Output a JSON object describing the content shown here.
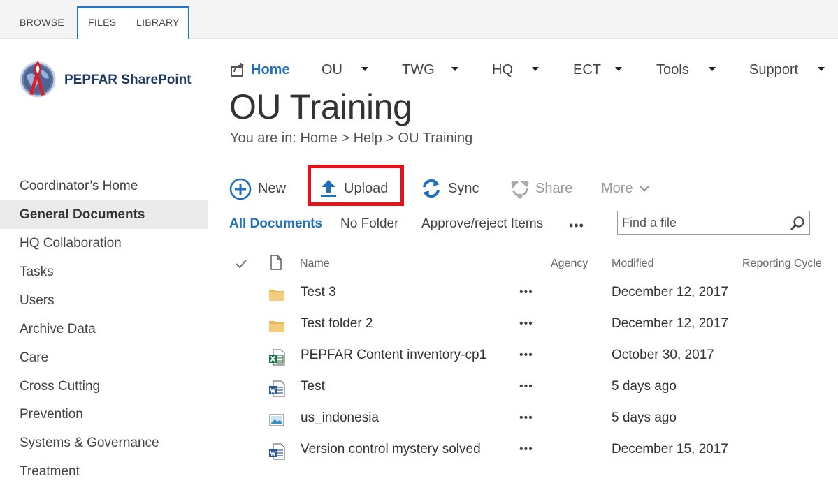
{
  "ribbon": {
    "tabs": [
      "BROWSE",
      "FILES",
      "LIBRARY"
    ]
  },
  "logo": {
    "text": "PEPFAR SharePoint"
  },
  "topnav": {
    "home": "Home",
    "items": [
      "OU",
      "TWG",
      "HQ",
      "ECT",
      "Tools",
      "Support"
    ]
  },
  "page": {
    "title": "OU Training",
    "breadcrumb": "You are in: Home > Help > OU Training"
  },
  "leftnav": {
    "items": [
      "Coordinator’s Home",
      "General Documents",
      "HQ Collaboration",
      "Tasks",
      "Users",
      "Archive Data",
      "Care",
      "Cross Cutting",
      "Prevention",
      "Systems & Governance",
      "Treatment"
    ],
    "selected": "General Documents"
  },
  "commands": {
    "new": "New",
    "upload": "Upload",
    "sync": "Sync",
    "share": "Share",
    "more": "More"
  },
  "views": {
    "items": [
      "All Documents",
      "No Folder",
      "Approve/reject Items"
    ],
    "ellipsis": "•••"
  },
  "search": {
    "placeholder": "Find a file"
  },
  "table": {
    "columns": {
      "name": "Name",
      "agency": "Agency",
      "modified": "Modified",
      "reporting_cycle": "Reporting Cycle"
    },
    "rows": [
      {
        "name": "Test 3",
        "modified": "December 12, 2017",
        "type": "folder",
        "dots": "•••"
      },
      {
        "name": "Test folder 2",
        "modified": "December 12, 2017",
        "type": "folder",
        "dots": "•••"
      },
      {
        "name": "PEPFAR Content inventory-cp1",
        "modified": "October 30, 2017",
        "type": "excel",
        "dots": "•••"
      },
      {
        "name": "Test",
        "modified": "5 days ago",
        "type": "word",
        "dots": "•••"
      },
      {
        "name": "us_indonesia",
        "modified": "5 days ago",
        "type": "image",
        "dots": "•••"
      },
      {
        "name": "Version control mystery solved",
        "modified": "December 15, 2017",
        "type": "word",
        "dots": "•••"
      }
    ]
  },
  "colors": {
    "accent": "#1f6fbf",
    "highlight": "#e3121b",
    "folder": "#f0c36d",
    "excel": "#217346",
    "word": "#2b579a"
  }
}
